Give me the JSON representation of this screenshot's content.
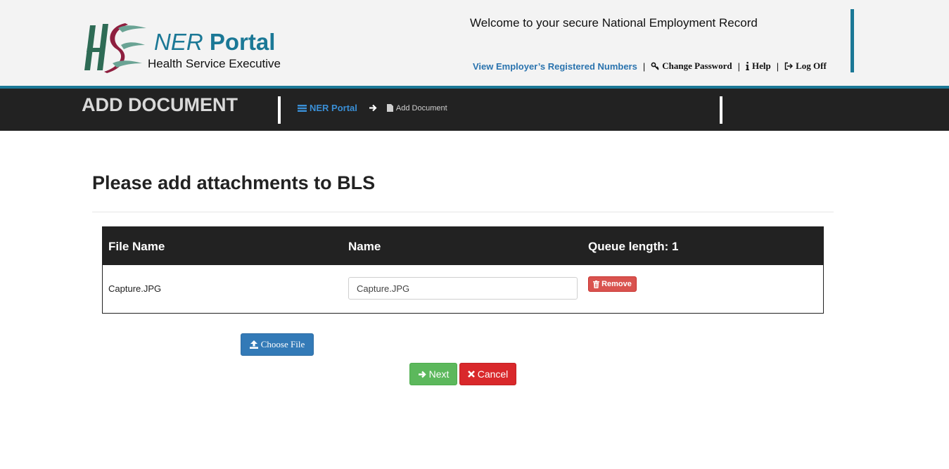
{
  "header": {
    "logo_text": "HSE",
    "portal_title_ner": "NER",
    "portal_title_portal": "Portal",
    "org_name": "Health Service Executive",
    "welcome": "Welcome to your secure National Employment Record",
    "links": {
      "employer_numbers": "View Employer’s Registered Numbers",
      "change_password": "Change Password",
      "help": "Help",
      "log_off": "Log Off",
      "separator": "|"
    }
  },
  "titlebar": {
    "page_heading": "ADD DOCUMENT",
    "breadcrumb_home": "NER Portal",
    "breadcrumb_current": "Add Document"
  },
  "main": {
    "title": "Please add attachments to BLS",
    "table": {
      "headers": [
        "File Name",
        "Name",
        "Queue length: 1"
      ],
      "rows": [
        {
          "file_name": "Capture.JPG",
          "name_value": "Capture.JPG",
          "remove_label": "Remove"
        }
      ]
    },
    "choose_file_label": "Choose File",
    "next_label": "Next",
    "cancel_label": "Cancel"
  },
  "icons": {
    "key": "key-icon",
    "help": "info-icon",
    "logoff": "sign-out-icon",
    "home": "list-icon",
    "arrow": "arrow-right-icon",
    "doc": "file-icon",
    "trash": "trash-icon",
    "upload": "upload-icon",
    "next": "arrow-circle-right-icon",
    "cancel": "times-icon"
  },
  "colors": {
    "brand_teal": "#1b7896",
    "title_bar": "#222222",
    "link_blue": "#2a73ae",
    "primary": "#337ab7",
    "success": "#5cb85c",
    "danger": "#d9534f"
  }
}
